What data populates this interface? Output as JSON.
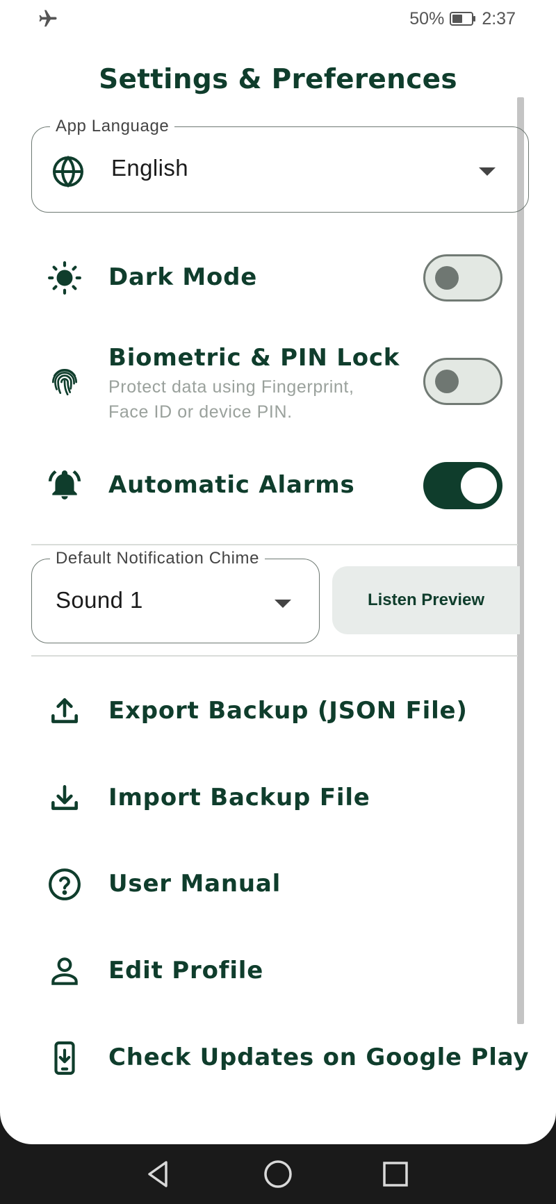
{
  "status_bar": {
    "battery_percent": "50%",
    "time": "2:37"
  },
  "title": "Settings & Preferences",
  "language": {
    "legend": "App Language",
    "value": "English"
  },
  "toggles": [
    {
      "label": "Dark Mode",
      "on": false
    },
    {
      "label": "Biometric & PIN Lock",
      "subtitle": "Protect data using Fingerprint,\nFace ID or device PIN.",
      "on": false
    },
    {
      "label": "Automatic Alarms",
      "on": true
    }
  ],
  "chime": {
    "legend": "Default Notification Chime",
    "value": "Sound 1",
    "preview_label": "Listen Preview"
  },
  "actions": [
    {
      "label": "Export Backup (JSON File)",
      "icon": "upload-icon"
    },
    {
      "label": "Import Backup File",
      "icon": "download-icon"
    },
    {
      "label": "User Manual",
      "icon": "help-circle-icon"
    },
    {
      "label": "Edit Profile",
      "icon": "person-icon"
    },
    {
      "label": "Check Updates on Google Play",
      "icon": "phone-download-icon"
    }
  ],
  "colors": {
    "primary": "#0f3d2c",
    "toggle_off_track": "#e3e8e3",
    "preview_button_bg": "#e8ecea"
  }
}
